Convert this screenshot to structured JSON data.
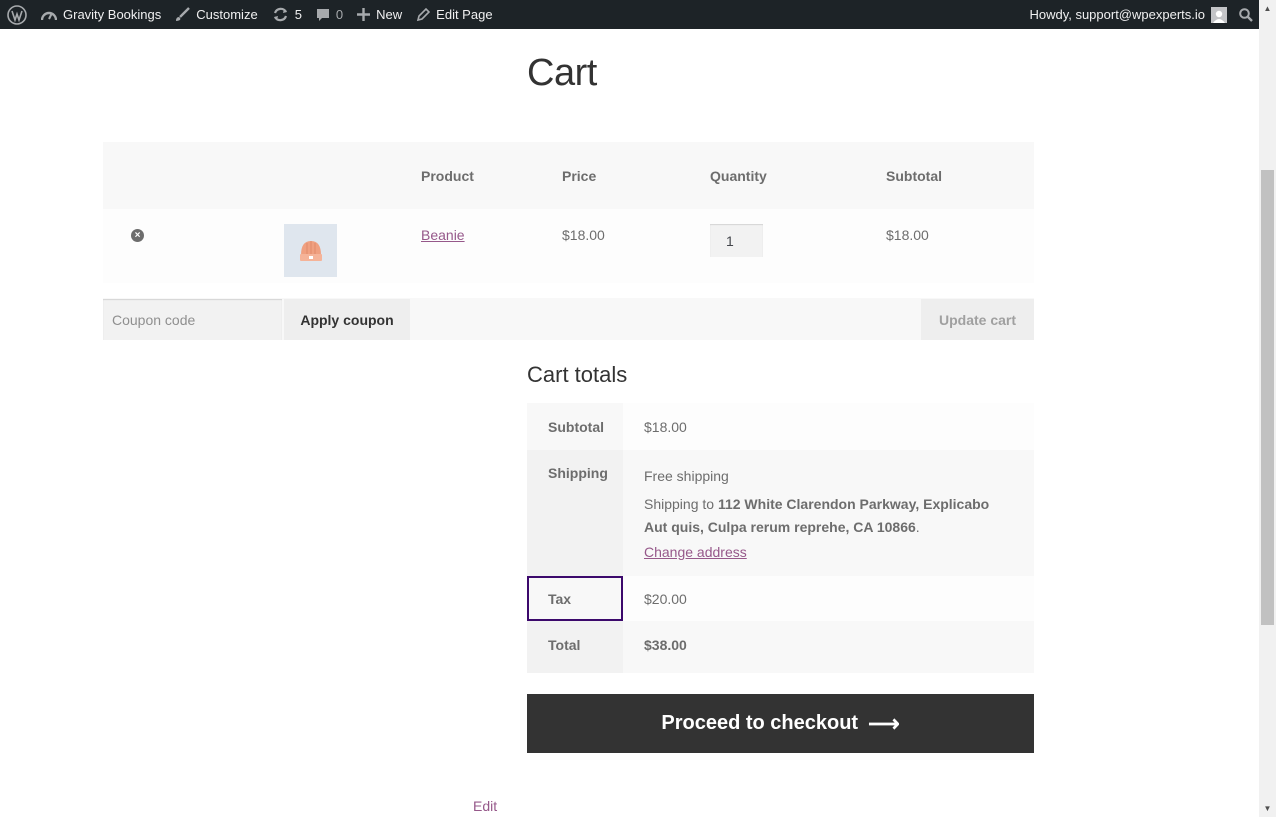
{
  "adminbar": {
    "site_name": "Gravity Bookings",
    "customize": "Customize",
    "updates_count": "5",
    "comments_count": "0",
    "new": "New",
    "edit_page": "Edit Page",
    "howdy": "Howdy, support@wpexperts.io"
  },
  "page": {
    "title": "Cart"
  },
  "cart": {
    "headers": {
      "product": "Product",
      "price": "Price",
      "quantity": "Quantity",
      "subtotal": "Subtotal"
    },
    "items": [
      {
        "name": "Beanie",
        "price": "$18.00",
        "quantity": "1",
        "subtotal": "$18.00"
      }
    ],
    "coupon_placeholder": "Coupon code",
    "apply_coupon": "Apply coupon",
    "update_cart": "Update cart"
  },
  "totals": {
    "title": "Cart totals",
    "subtotal_label": "Subtotal",
    "subtotal_value": "$18.00",
    "shipping_label": "Shipping",
    "shipping_method": "Free shipping",
    "shipping_to_prefix": "Shipping to ",
    "shipping_address": "112 White Clarendon Parkway, Explicabo Aut quis, Culpa rerum reprehe, CA 10866",
    "shipping_suffix": ".",
    "change_address": "Change address",
    "tax_label": "Tax",
    "tax_value": "$20.00",
    "total_label": "Total",
    "total_value": "$38.00",
    "checkout_label": "Proceed to checkout",
    "checkout_arrow": "⟶"
  },
  "footer": {
    "edit": "Edit"
  },
  "colors": {
    "accent": "#96588a",
    "highlight_border": "#3c096c",
    "adminbar": "#1d2327",
    "checkout": "#333333"
  }
}
